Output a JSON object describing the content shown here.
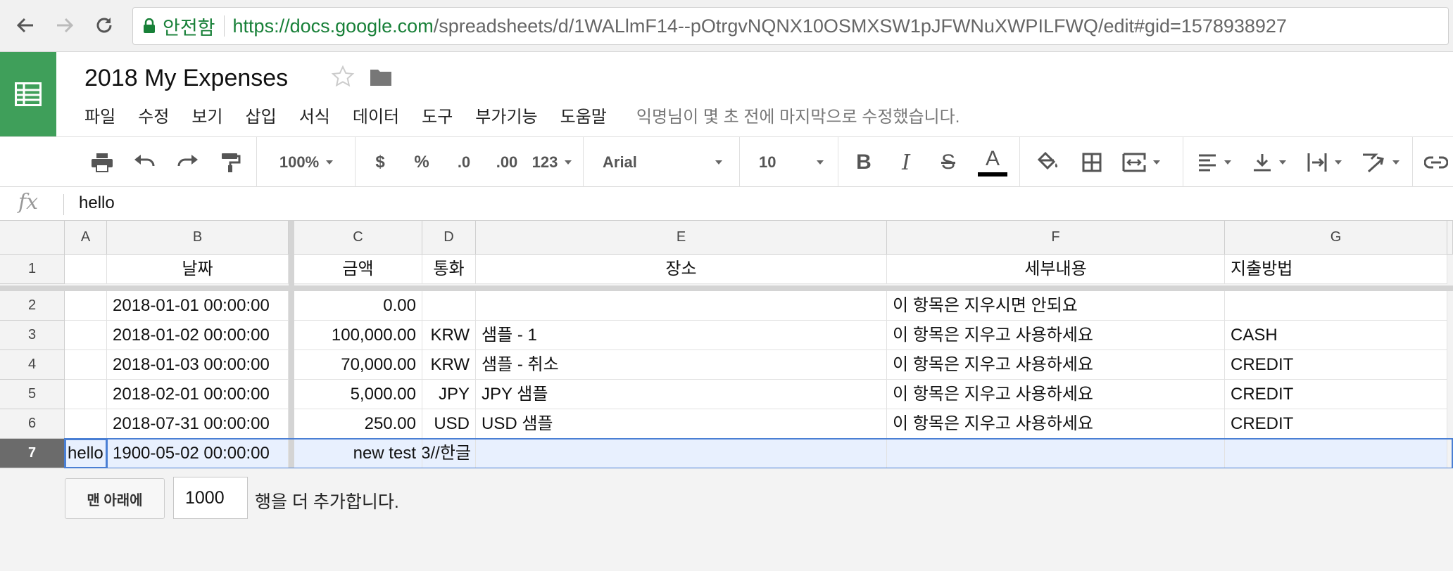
{
  "browser": {
    "secure_label": "안전함",
    "url_scheme_host": "https://docs.google.com",
    "url_path": "/spreadsheets/d/1WALlmF14--pOtrgvNQNX10OSMXSW1pJFWNuXWPILFWQ/edit#gid=1578938927"
  },
  "app": {
    "title": "2018 My Expenses",
    "menu": [
      "파일",
      "수정",
      "보기",
      "삽입",
      "서식",
      "데이터",
      "도구",
      "부가기능",
      "도움말"
    ],
    "last_edit": "익명님이 몇 초 전에 마지막으로 수정했습니다.",
    "accent_color": "#3f9f5a"
  },
  "toolbar": {
    "zoom": "100%",
    "currency": "$",
    "percent": "%",
    "dec_decrease": ".0",
    "dec_increase": ".00",
    "more_formats": "123",
    "font": "Arial",
    "font_size": "10",
    "bold": "B",
    "italic": "I",
    "strike": "S",
    "text_color": "A",
    "text_color_value": "#000000"
  },
  "formula_bar": {
    "fx": "fx",
    "value": "hello"
  },
  "grid": {
    "columns": [
      "A",
      "B",
      "C",
      "D",
      "E",
      "F",
      "G"
    ],
    "rows": [
      {
        "num": "1",
        "a": "",
        "b": "날짜",
        "c": "금액",
        "d": "통화",
        "e": "장소",
        "f": "세부내용",
        "g": "지출방법"
      },
      {
        "num": "2",
        "a": "",
        "b": "2018-01-01 00:00:00",
        "c": "0.00",
        "d": "",
        "e": "",
        "f": "이 항목은 지우시면 안되요",
        "g": ""
      },
      {
        "num": "3",
        "a": "",
        "b": "2018-01-02 00:00:00",
        "c": "100,000.00",
        "d": "KRW",
        "e": "샘플 - 1",
        "f": "이 항목은 지우고 사용하세요",
        "g": "CASH"
      },
      {
        "num": "4",
        "a": "",
        "b": "2018-01-03 00:00:00",
        "c": "70,000.00",
        "d": "KRW",
        "e": "샘플 - 취소",
        "f": "이 항목은 지우고 사용하세요",
        "g": "CREDIT"
      },
      {
        "num": "5",
        "a": "",
        "b": "2018-02-01 00:00:00",
        "c": "5,000.00",
        "d": "JPY",
        "e": "JPY 샘플",
        "f": "이 항목은 지우고 사용하세요",
        "g": "CREDIT"
      },
      {
        "num": "6",
        "a": "",
        "b": "2018-07-31 00:00:00",
        "c": "250.00",
        "d": "USD",
        "e": "USD 샘플",
        "f": "이 항목은 지우고 사용하세요",
        "g": "CREDIT"
      },
      {
        "num": "7",
        "a": "hello",
        "b": "1900-05-02 00:00:00",
        "c": "new test",
        "d": "3//한글",
        "e": "",
        "f": "",
        "g": ""
      }
    ]
  },
  "footer": {
    "add_button": "맨 아래에",
    "rows_value": "1000",
    "rows_text": "행을 더 추가합니다."
  }
}
